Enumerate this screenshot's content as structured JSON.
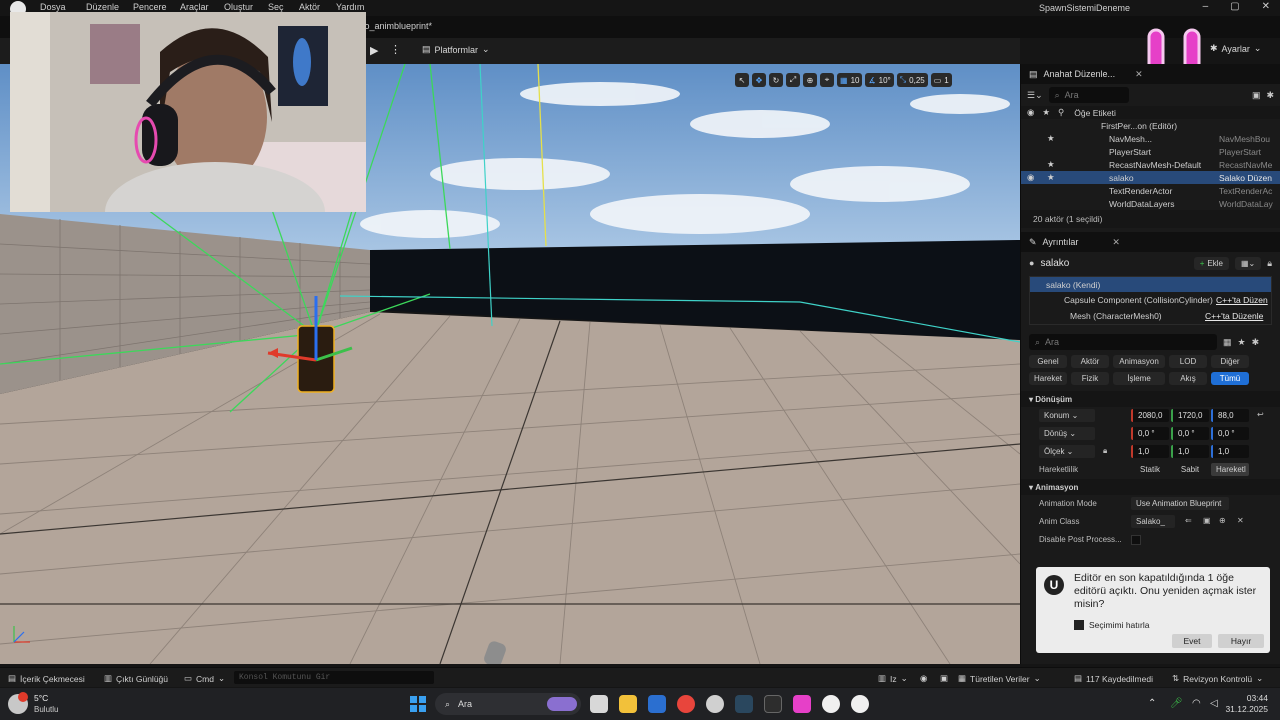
{
  "colors": {
    "accent": "#1f6fd6",
    "selection": "#284a7a",
    "sky": "#7aa6d6",
    "floor": "#b3a59a",
    "grid_green": "#3cd85a",
    "grid_cyan": "#3fd2c8",
    "grid_yellow": "#e5e04a",
    "overlay_pink": "#e640c8"
  },
  "menu": [
    "Dosya",
    "Düzenle",
    "Pencere",
    "Araçlar",
    "Oluştur",
    "Seç",
    "Aktör",
    "Yardım"
  ],
  "project_name": "SpawnSistemiDeneme",
  "window_buttons": [
    "–",
    "▢",
    "✕"
  ],
  "doc_tab": "ko_animblueprint*",
  "toolbar": {
    "platforms": "Platformlar",
    "settings": "Ayarlar"
  },
  "viewport_tools": {
    "grid": "10",
    "angle": "10°",
    "scale": "0,25",
    "camera": "1"
  },
  "outliner": {
    "tab": "Anahat Düzenle...",
    "search_placeholder": "Ara",
    "column": "Öğe Etiketi",
    "rows": [
      {
        "name": "FirstPer...on (Editör)",
        "type": ""
      },
      {
        "name": "NavMesh...",
        "type": "NavMeshBou"
      },
      {
        "name": "PlayerStart",
        "type": "PlayerStart"
      },
      {
        "name": "RecastNavMesh-Default",
        "type": "RecastNavMe"
      },
      {
        "name": "salako",
        "type": "Salako Düzen"
      },
      {
        "name": "TextRenderActor",
        "type": "TextRenderAc"
      },
      {
        "name": "WorldDataLayers",
        "type": "WorldDataLay"
      }
    ],
    "footer": "20 aktör (1 seçildi)"
  },
  "details": {
    "tab": "Ayrıntılar",
    "actor": "salako",
    "add_label": "Ekle",
    "components": [
      {
        "name": "salako (Kendi)",
        "link": ""
      },
      {
        "name": "Capsule Component (CollisionCylinder)",
        "link": "C++'ta Düzen"
      },
      {
        "name": "Mesh (CharacterMesh0)",
        "link": "C++'ta Düzenle"
      }
    ],
    "search_placeholder": "Ara",
    "filters_row1": [
      "Genel",
      "Aktör",
      "Animasyon",
      "LOD",
      "Diğer"
    ],
    "filters_row2": [
      "Hareket",
      "Fizik",
      "İşleme",
      "Akış",
      "Tümü"
    ],
    "section_transform": "Dönüşüm",
    "location": {
      "label": "Konum",
      "x": "2080,0",
      "y": "1720,0",
      "z": "88,0"
    },
    "rotation": {
      "label": "Dönüş",
      "x": "0,0 °",
      "y": "0,0 °",
      "z": "0,0 °"
    },
    "scale": {
      "label": "Ölçek",
      "x": "1,0",
      "y": "1,0",
      "z": "1,0"
    },
    "mobility": {
      "label": "Hareketlilik",
      "options": [
        "Statik",
        "Sabit",
        "Hareketl"
      ]
    },
    "section_animation": "Animasyon",
    "anim_mode": {
      "label": "Animation Mode",
      "value": "Use Animation Blueprint"
    },
    "anim_class": {
      "label": "Anim Class",
      "value": "Salako_"
    },
    "disable_post": {
      "label": "Disable Post Process..."
    }
  },
  "notification": {
    "message": "Editör en son kapatıldığında 1 öğe editörü açıktı. Onu yeniden açmak ister misin?",
    "remember": "Seçimimi hatırla",
    "yes": "Evet",
    "no": "Hayır"
  },
  "statusbar": {
    "content_drawer": "İçerik Çekmecesi",
    "output_log": "Çıktı Günlüğü",
    "cmd": "Cmd",
    "console_placeholder": "Konsol Komutunu Gir",
    "trace": "Iz",
    "derived_data": "Türetilen Veriler",
    "saved": "117 Kaydedilmedi",
    "revision": "Revizyon Kontrolü"
  },
  "taskbar": {
    "weather_temp": "5°C",
    "weather_desc": "Bulutlu",
    "search": "Ara",
    "time": "03:44",
    "date": "31.12.2025"
  }
}
